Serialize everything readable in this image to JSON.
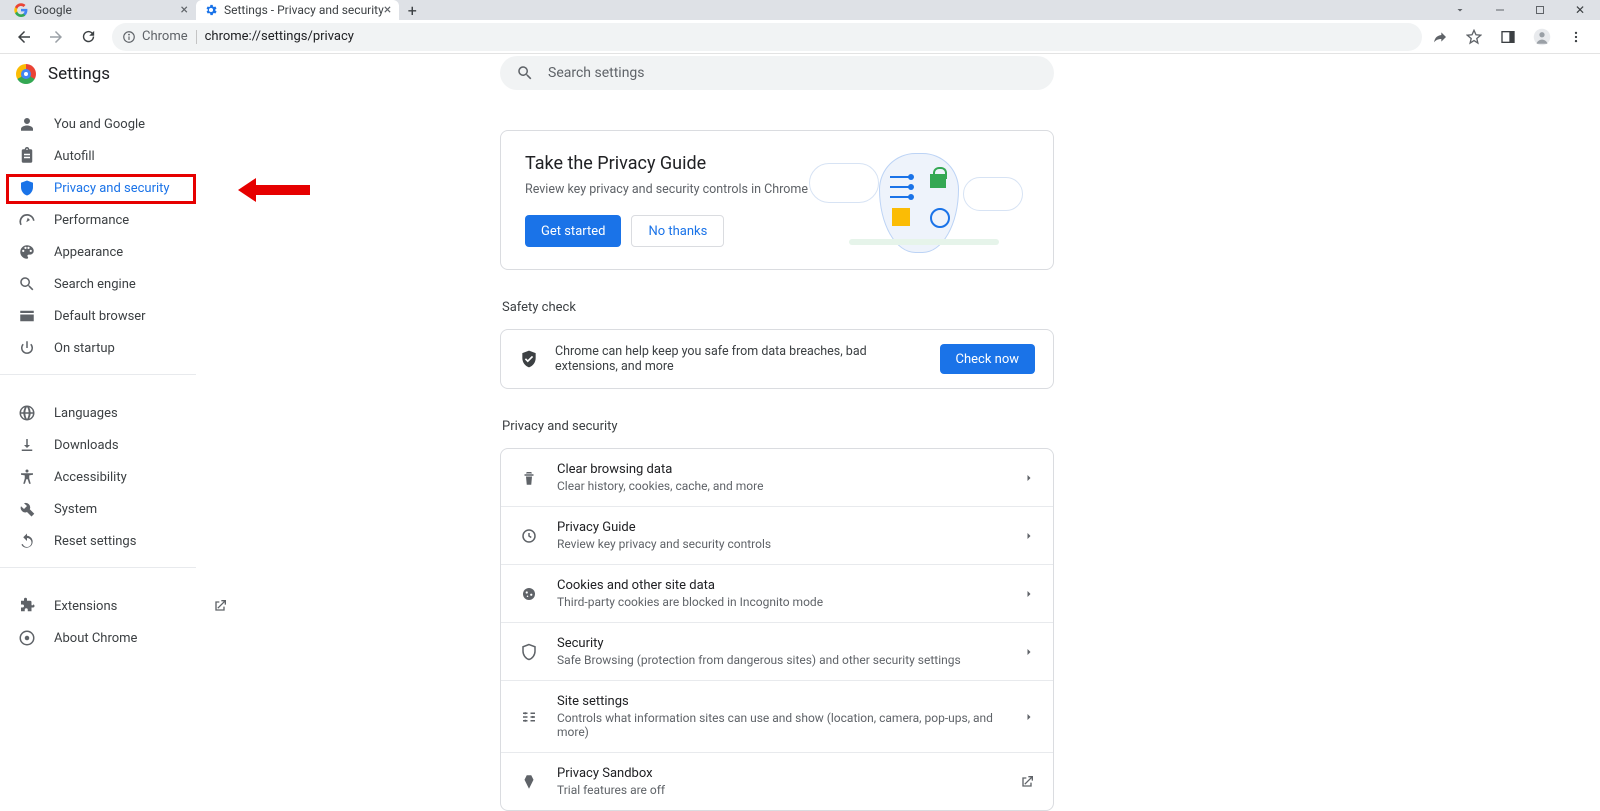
{
  "tabs": [
    {
      "label": "Google"
    },
    {
      "label": "Settings - Privacy and security"
    }
  ],
  "omnibox": {
    "chrome_label": "Chrome",
    "url": "chrome://settings/privacy"
  },
  "header": {
    "title": "Settings"
  },
  "nav": {
    "items": [
      {
        "label": "You and Google",
        "icon": "person"
      },
      {
        "label": "Autofill",
        "icon": "clipboard"
      },
      {
        "label": "Privacy and security",
        "icon": "shield",
        "selected": true
      },
      {
        "label": "Performance",
        "icon": "speed"
      },
      {
        "label": "Appearance",
        "icon": "palette"
      },
      {
        "label": "Search engine",
        "icon": "search"
      },
      {
        "label": "Default browser",
        "icon": "browser"
      },
      {
        "label": "On startup",
        "icon": "power"
      }
    ],
    "items2": [
      {
        "label": "Languages",
        "icon": "globe"
      },
      {
        "label": "Downloads",
        "icon": "download"
      },
      {
        "label": "Accessibility",
        "icon": "a11y"
      },
      {
        "label": "System",
        "icon": "wrench"
      },
      {
        "label": "Reset settings",
        "icon": "restore"
      }
    ],
    "items3": [
      {
        "label": "Extensions",
        "icon": "puzzle",
        "external": true
      },
      {
        "label": "About Chrome",
        "icon": "chrome"
      }
    ]
  },
  "search": {
    "placeholder": "Search settings"
  },
  "guide": {
    "title": "Take the Privacy Guide",
    "subtitle": "Review key privacy and security controls in Chrome",
    "primary": "Get started",
    "secondary": "No thanks"
  },
  "safety": {
    "heading": "Safety check",
    "text": "Chrome can help keep you safe from data breaches, bad extensions, and more",
    "button": "Check now"
  },
  "privacy": {
    "heading": "Privacy and security",
    "rows": [
      {
        "title": "Clear browsing data",
        "sub": "Clear history, cookies, cache, and more"
      },
      {
        "title": "Privacy Guide",
        "sub": "Review key privacy and security controls"
      },
      {
        "title": "Cookies and other site data",
        "sub": "Third-party cookies are blocked in Incognito mode"
      },
      {
        "title": "Security",
        "sub": "Safe Browsing (protection from dangerous sites) and other security settings"
      },
      {
        "title": "Site settings",
        "sub": "Controls what information sites can use and show (location, camera, pop-ups, and more)"
      },
      {
        "title": "Privacy Sandbox",
        "sub": "Trial features are off"
      }
    ]
  }
}
